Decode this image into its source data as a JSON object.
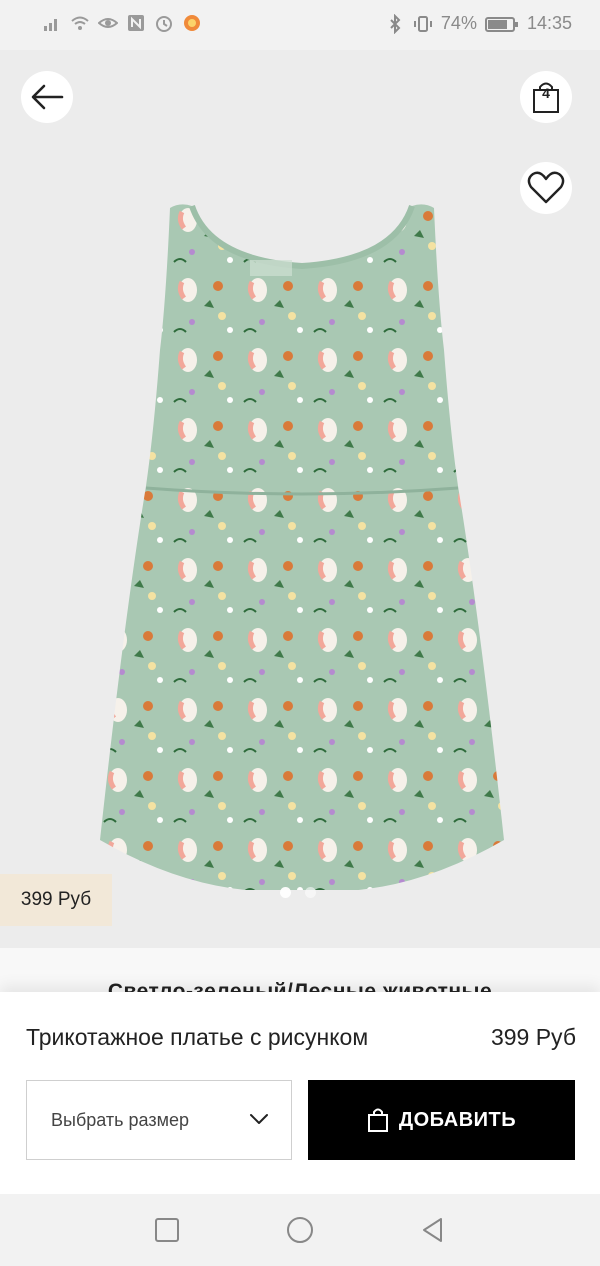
{
  "status_bar": {
    "battery": "74%",
    "time": "14:35"
  },
  "header": {
    "cart_count": "4"
  },
  "product": {
    "price_tag": "399 Руб",
    "color_name": "Светло-зеленый/Лесные животные",
    "title": "Трикотажное платье с рисунком",
    "price": "399 Руб",
    "carousel": {
      "count": 2,
      "active_index": 0
    }
  },
  "actions": {
    "size_placeholder": "Выбрать размер",
    "add_label": "ДОБАВИТЬ"
  },
  "colors": {
    "price_tag_bg": "#f2e8d8",
    "dress": "#a9c8b3",
    "add_button_bg": "#000000"
  },
  "icons": {
    "back": "arrow-left-icon",
    "cart": "shopping-bag-icon",
    "favorite": "heart-icon",
    "select": "chevron-down-icon",
    "add": "shopping-bag-icon"
  }
}
